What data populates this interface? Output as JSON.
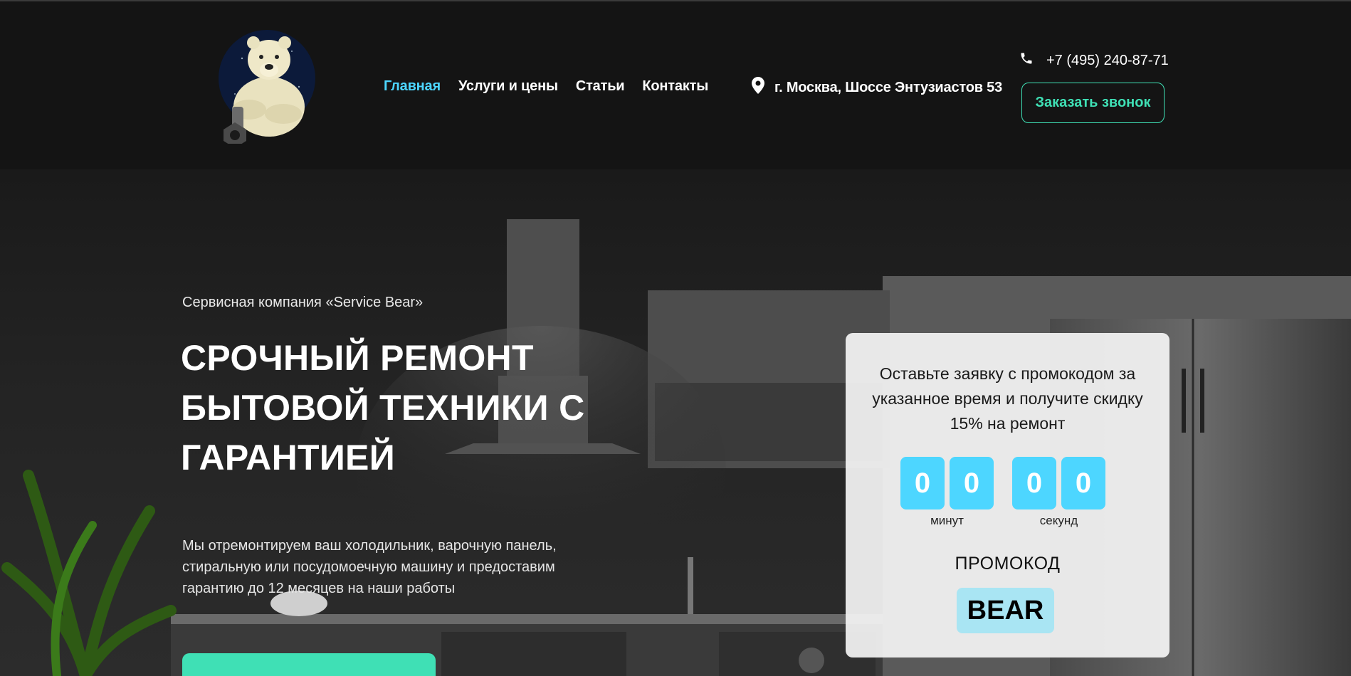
{
  "header": {
    "logo_alt": "Service Bear",
    "nav": [
      {
        "label": "Главная",
        "active": true
      },
      {
        "label": "Услуги и цены",
        "active": false
      },
      {
        "label": "Статьи",
        "active": false
      },
      {
        "label": "Контакты",
        "active": false
      }
    ],
    "address": "г. Москва, Шоссе Энтузиастов 53",
    "phone": "+7 (495) 240-87-71",
    "callback_button": "Заказать звонок"
  },
  "hero": {
    "subtitle": "Сервисная компания «Service Bear»",
    "headline": "Срочный ремонт бытовой техники с гарантией",
    "description": "Мы отремонтируем ваш холодильник, варочную панель, стиральную или посудомоечную машину и предоставим гарантию до 12 месяцев на наши работы"
  },
  "promo_card": {
    "text": "Оставьте заявку с промокодом за указанное время и получите скидку 15% на ремонт",
    "timer": {
      "minutes_digits": [
        "0",
        "0"
      ],
      "seconds_digits": [
        "0",
        "0"
      ],
      "minutes_label": "минут",
      "seconds_label": "секунд"
    },
    "promo_label": "ПРОМОКОД",
    "promo_code": "BEAR"
  },
  "colors": {
    "accent_cyan": "#4dd6ff",
    "accent_green": "#3fe0b5",
    "background": "#151515"
  },
  "icons": {
    "location": "map-pin-icon",
    "phone": "phone-icon",
    "logo": "polar-bear-logo"
  }
}
